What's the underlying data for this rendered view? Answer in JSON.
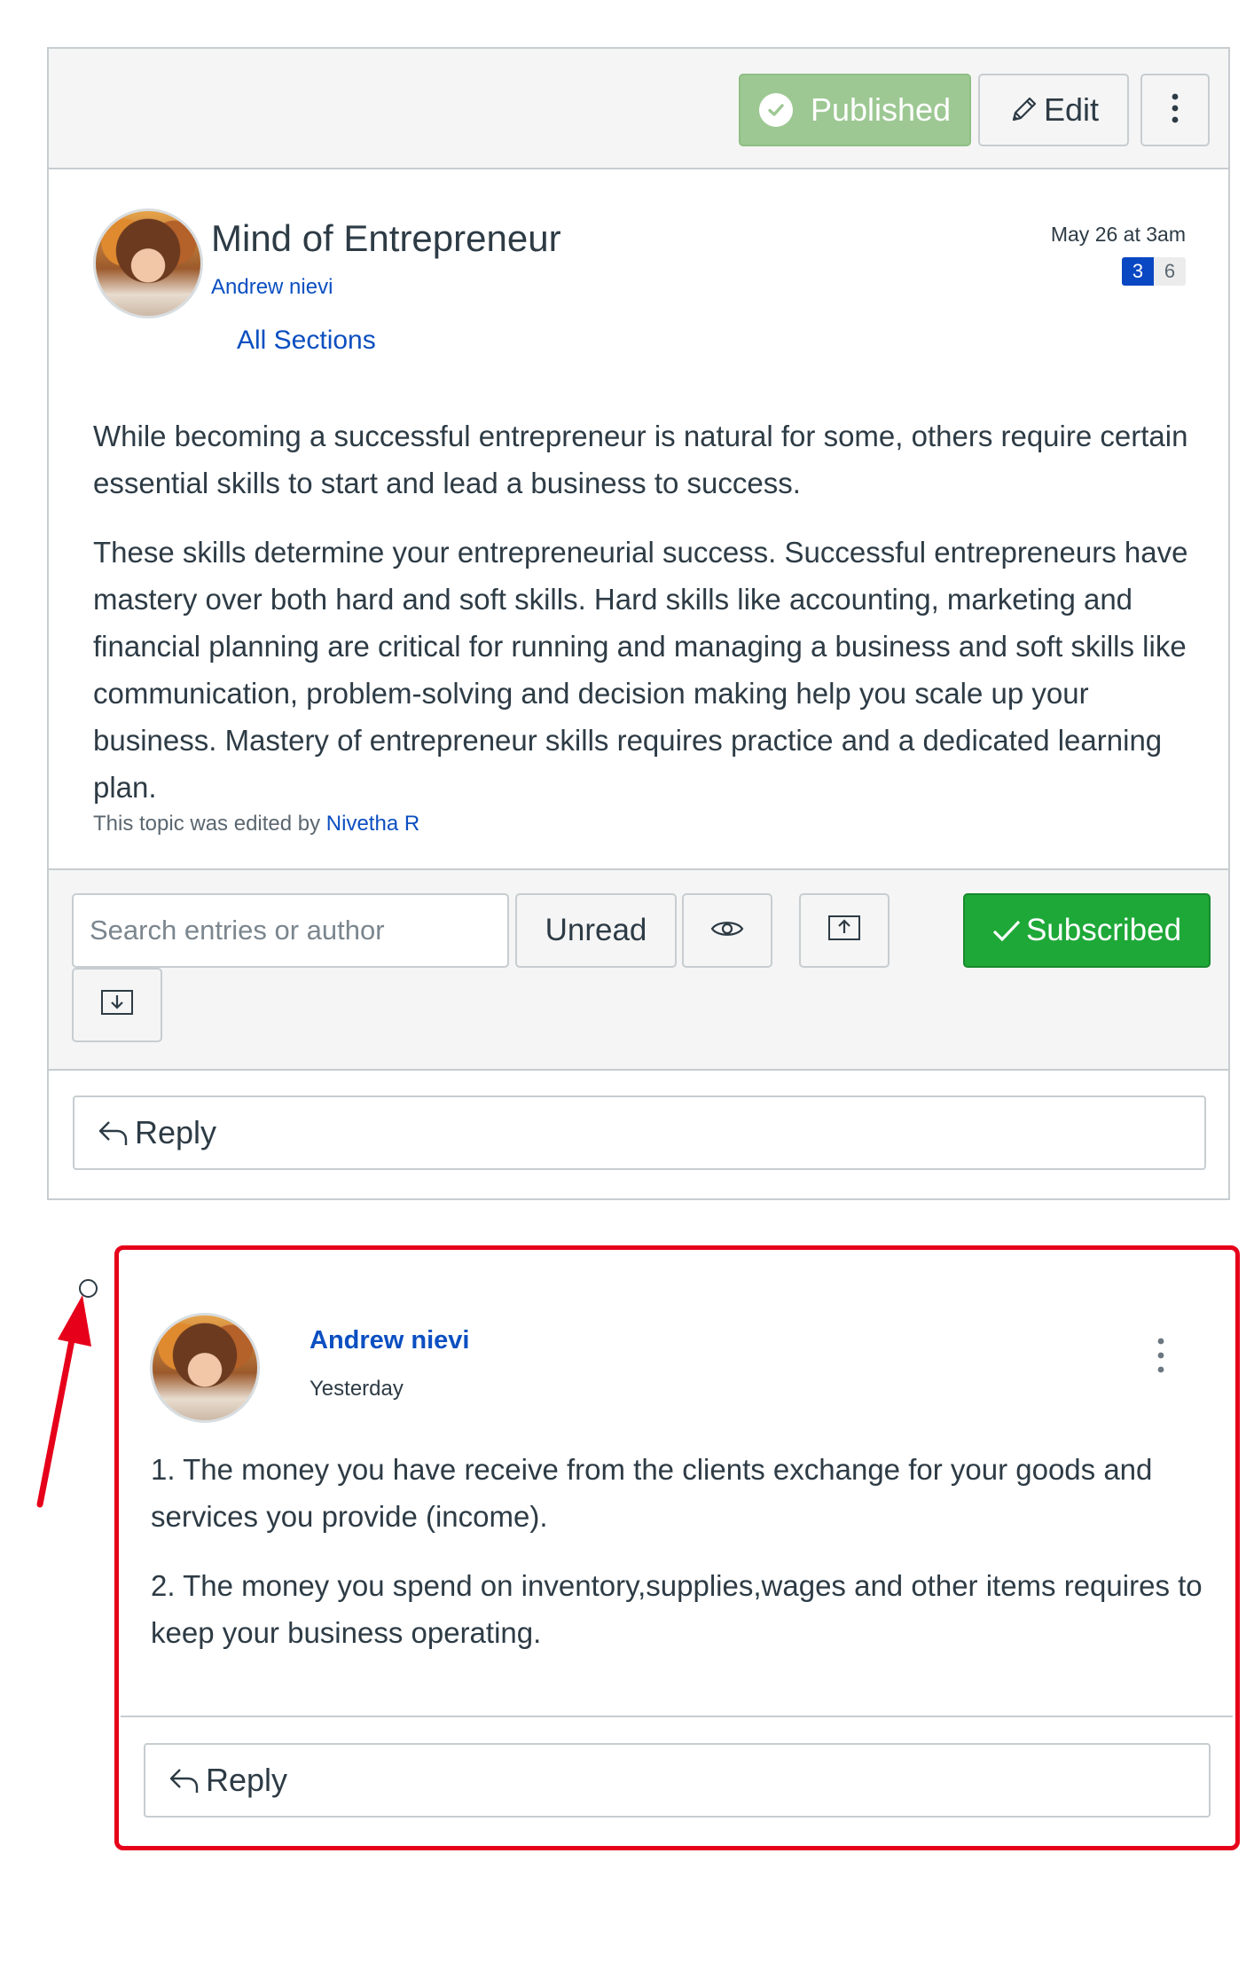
{
  "toolbar": {
    "published_label": "Published",
    "edit_label": "Edit",
    "status_color": "#9dc893"
  },
  "topic": {
    "title": "Mind of Entrepreneur",
    "author": "Andrew nievi",
    "date": "May 26 at 3am",
    "unread_count": "3",
    "total_count": "6",
    "sections": "All Sections",
    "paragraphs": [
      "While becoming a successful entrepreneur is natural for some, others require certain essential skills to start and lead a business to success.",
      "These skills determine your entrepreneurial success. Successful entrepreneurs have mastery over both hard and soft skills. Hard skills like accounting, marketing and financial planning are critical for running and managing a business and soft skills like communication, problem-solving and decision making help you scale up your business. Mastery of entrepreneur skills requires practice and a dedicated learning plan."
    ],
    "edited_prefix": "This topic was edited by",
    "edited_by": "Nivetha R"
  },
  "filters": {
    "search_placeholder": "Search entries or author",
    "unread_label": "Unread",
    "subscribed_label": "Subscribed",
    "subscribed_color": "#1ea838"
  },
  "topic_reply_label": "Reply",
  "entry": {
    "author": "Andrew nievi",
    "time": "Yesterday",
    "paragraphs": [
      "1. The money you have receive from the clients exchange for your goods and services you provide (income).",
      "2. The money you spend on inventory,supplies,wages and other items requires to keep your business operating."
    ],
    "reply_label": "Reply",
    "highlight_color": "#e6001a"
  },
  "icons": {
    "published": "check-circle-icon",
    "edit": "pencil-icon",
    "more": "kebab-menu-icon",
    "eye": "eye-icon",
    "upload": "upload-icon",
    "download": "download-icon",
    "subscribed": "checkmark-icon",
    "reply": "reply-arrow-icon",
    "annotation": "red-arrow-icon"
  }
}
